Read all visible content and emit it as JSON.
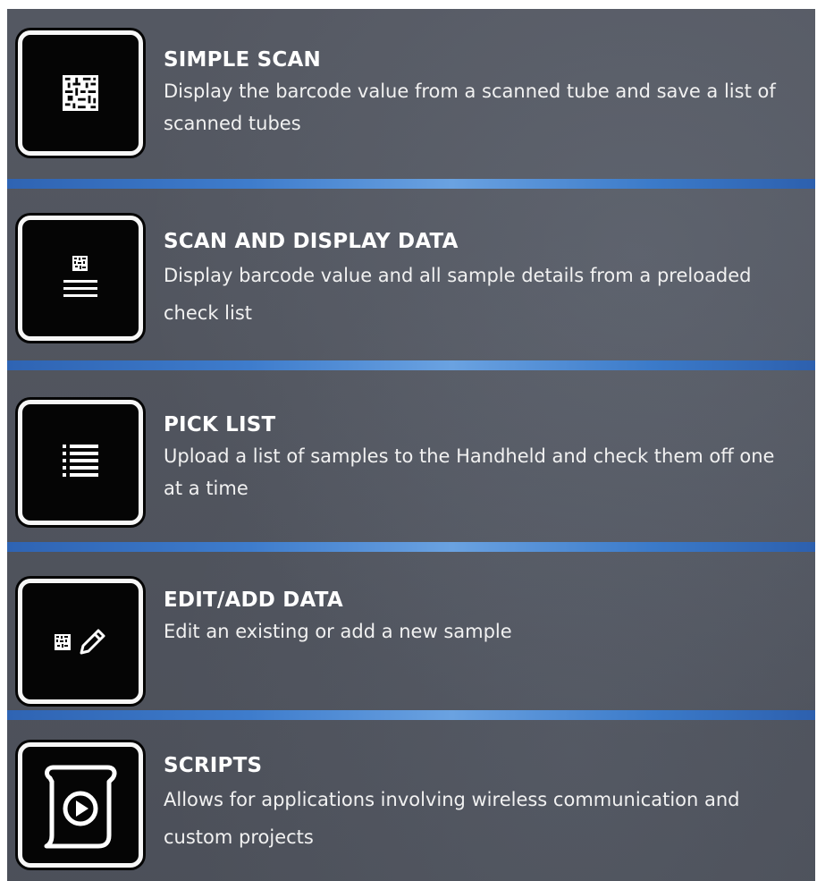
{
  "menu": {
    "items": [
      {
        "title": "SIMPLE SCAN",
        "description": "Display the barcode value from a scanned tube and save a list of scanned tubes",
        "icon": "barcode-icon"
      },
      {
        "title": "SCAN AND DISPLAY DATA",
        "description": "Display barcode value and all sample details from a preloaded check list",
        "icon": "barcode-list-icon"
      },
      {
        "title": "PICK LIST",
        "description": "Upload a list of samples to the Handheld and check them off one at a time",
        "icon": "list-icon"
      },
      {
        "title": "EDIT/ADD DATA",
        "description": "Edit an existing or add a new sample",
        "icon": "barcode-edit-icon"
      },
      {
        "title": "SCRIPTS",
        "description": "Allows for applications involving wireless communication and custom projects",
        "icon": "script-play-icon"
      }
    ]
  },
  "colors": {
    "panel_background": "#4f535d",
    "divider_accent": "#3e7ccc",
    "icon_background": "#050505",
    "icon_border": "#f7f7f7",
    "text": "#ffffff"
  }
}
